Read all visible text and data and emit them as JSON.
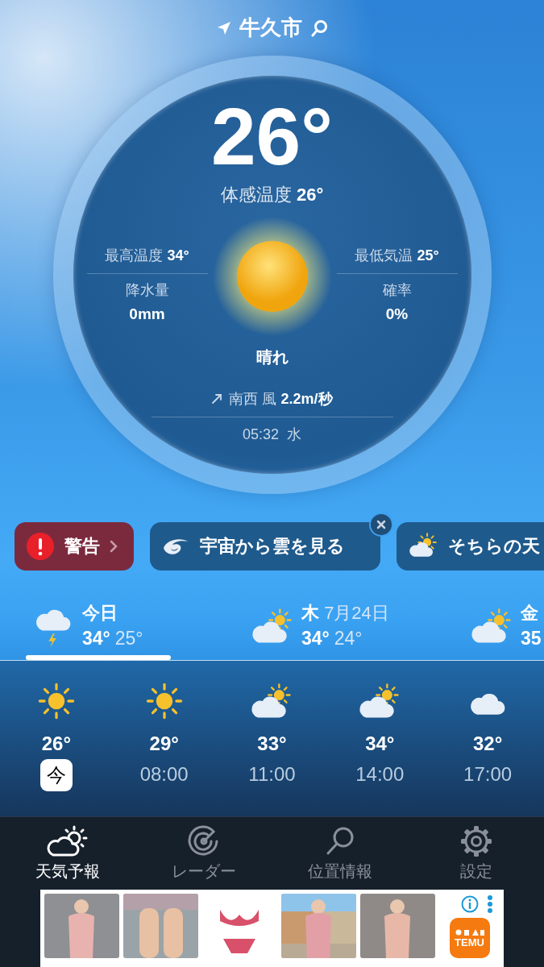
{
  "header": {
    "location": "牛久市"
  },
  "current": {
    "kind": "sunny",
    "temperature": "26°",
    "feels_like": "体感温度 **26°**",
    "high": "最高温度 **34°**",
    "low": "最低気温 **25°**",
    "precip_label": "降水量",
    "precip": "0mm",
    "chance_label": "確率",
    "chance": "0%",
    "condition": "晴れ",
    "wind": "南西 風 **2.2m/秒**",
    "updated": "05:32  水"
  },
  "chips": [
    {
      "kind": "warning",
      "label": "警告",
      "closable": false
    },
    {
      "kind": "satellite",
      "label": "宇宙から雲を見る",
      "closable": true
    },
    {
      "kind": "weather",
      "label": "そちらの天",
      "closable": false
    }
  ],
  "daily": [
    {
      "kind": "storm",
      "day": "今日",
      "high": "34°",
      "low": "25°",
      "selected": true
    },
    {
      "kind": "partly_cloudy",
      "day": "木",
      "date": "7月24日",
      "high": "34°",
      "low": "24°",
      "selected": false
    },
    {
      "kind": "partly_cloudy",
      "day": "金",
      "high": "35",
      "selected": false
    }
  ],
  "hourly": [
    {
      "kind": "sun",
      "temp": "26°",
      "time": "今",
      "now": true
    },
    {
      "kind": "sun",
      "temp": "29°",
      "time": "08:00",
      "now": false
    },
    {
      "kind": "partly_cloudy",
      "temp": "33°",
      "time": "11:00",
      "now": false
    },
    {
      "kind": "partly_cloudy",
      "temp": "34°",
      "time": "14:00",
      "now": false
    },
    {
      "kind": "cloud",
      "temp": "32°",
      "time": "17:00",
      "now": false
    }
  ],
  "tabs": [
    {
      "kind": "forecast",
      "label": "天気予報",
      "selected": true
    },
    {
      "kind": "radar",
      "label": "レーダー",
      "selected": false
    },
    {
      "kind": "search",
      "label": "位置情報",
      "selected": false
    },
    {
      "kind": "settings",
      "label": "設定",
      "selected": false
    }
  ],
  "ad": {
    "logo": "TEMU"
  }
}
